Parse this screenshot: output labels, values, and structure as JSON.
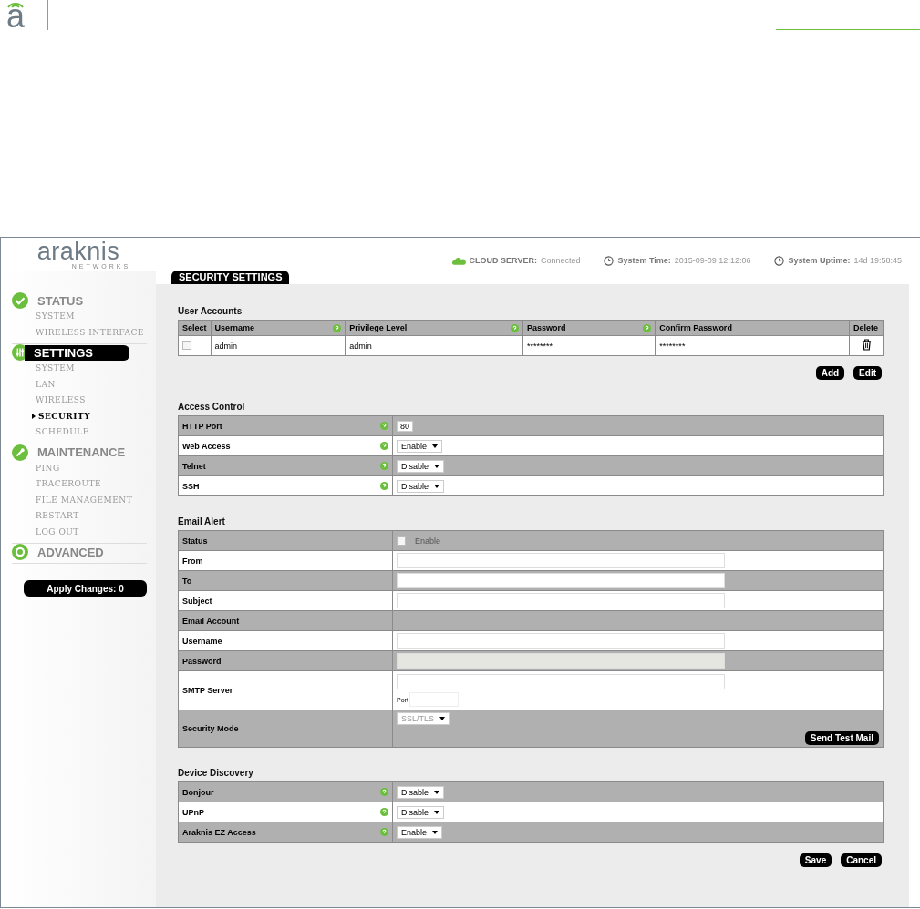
{
  "doc_header": {
    "logo": "a"
  },
  "app": {
    "brand": "araknis",
    "brand_sub": "NETWORKS"
  },
  "status_bar": [
    {
      "kind": "cloud",
      "label": "CLOUD SERVER:",
      "value": "Connected"
    },
    {
      "kind": "clock",
      "label": "System Time:",
      "value": "2015-09-09 12:12:06"
    },
    {
      "kind": "clock",
      "label": "System Uptime:",
      "value": "14d 19:58:45"
    }
  ],
  "sidebar": {
    "groups": [
      {
        "title": "STATUS",
        "kind": "check",
        "selected": false,
        "items": [
          {
            "label": "SYSTEM",
            "selected": false
          },
          {
            "label": "WIRELESS INTERFACE",
            "selected": false
          }
        ]
      },
      {
        "title": "SETTINGS",
        "kind": "sliders",
        "selected": true,
        "items": [
          {
            "label": "SYSTEM",
            "selected": false
          },
          {
            "label": "LAN",
            "selected": false
          },
          {
            "label": "WIRELESS",
            "selected": false
          },
          {
            "label": "SECURITY",
            "selected": true
          },
          {
            "label": "SCHEDULE",
            "selected": false
          }
        ]
      },
      {
        "title": "MAINTENANCE",
        "kind": "wrench",
        "selected": false,
        "items": [
          {
            "label": "PING",
            "selected": false
          },
          {
            "label": "TRACEROUTE",
            "selected": false
          },
          {
            "label": "FILE MANAGEMENT",
            "selected": false
          },
          {
            "label": "RESTART",
            "selected": false
          },
          {
            "label": "LOG OUT",
            "selected": false
          }
        ]
      },
      {
        "title": "ADVANCED",
        "kind": "gear",
        "selected": false
      }
    ],
    "apply_button": "Apply Changes: 0"
  },
  "page_title": "SECURITY SETTINGS",
  "user_accounts": {
    "heading": "User Accounts",
    "columns": [
      {
        "label": "Select",
        "help": false
      },
      {
        "label": "Username",
        "help": true
      },
      {
        "label": "Privilege Level",
        "help": true
      },
      {
        "label": "Password",
        "help": true
      },
      {
        "label": "Confirm Password",
        "help": false
      },
      {
        "label": "Delete",
        "help": false
      }
    ],
    "rows": [
      {
        "selected": false,
        "username": "admin",
        "privilege": "admin",
        "password": "********",
        "confirm": "********"
      }
    ],
    "buttons": [
      "Add",
      "Edit"
    ]
  },
  "access_control": {
    "heading": "Access Control",
    "rows": [
      {
        "label": "HTTP Port",
        "help": true,
        "kind": "input",
        "value": "80"
      },
      {
        "label": "Web Access",
        "help": true,
        "kind": "select",
        "value": "Enable"
      },
      {
        "label": "Telnet",
        "help": true,
        "kind": "select",
        "value": "Disable"
      },
      {
        "label": "SSH",
        "help": true,
        "kind": "select",
        "value": "Disable"
      }
    ]
  },
  "email_alert": {
    "heading": "Email Alert",
    "rows": [
      {
        "label": "Status",
        "kind": "checkbox",
        "value": "Enable",
        "checked": false
      },
      {
        "label": "From",
        "kind": "input"
      },
      {
        "label": "To",
        "kind": "input"
      },
      {
        "label": "Subject",
        "kind": "input"
      },
      {
        "label": "Email Account",
        "kind": "section"
      },
      {
        "label": "Username",
        "kind": "input"
      },
      {
        "label": "Password",
        "kind": "input",
        "disabled": true
      },
      {
        "label": "SMTP Server",
        "kind": "server",
        "port_label": "Port"
      },
      {
        "label": "Security Mode",
        "kind": "select",
        "value": "SSL/TLS",
        "button": "Send Test Mail"
      }
    ]
  },
  "device_discovery": {
    "heading": "Device Discovery",
    "rows": [
      {
        "label": "Bonjour",
        "help": true,
        "kind": "select",
        "value": "Disable"
      },
      {
        "label": "UPnP",
        "help": true,
        "kind": "select",
        "value": "Disable"
      },
      {
        "label": "Araknis EZ Access",
        "help": true,
        "kind": "select",
        "value": "Enable"
      }
    ]
  },
  "buttons": [
    "Save",
    "Cancel"
  ]
}
